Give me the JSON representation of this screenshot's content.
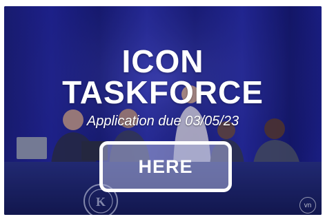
{
  "banner": {
    "title_line1": "ICON",
    "title_line2": "TASKFORCE",
    "subtitle": "Application due 03/05/23",
    "cta_label": "HERE",
    "watermark": "vn"
  },
  "colors": {
    "backdrop": "#10135e",
    "curtain": "#1a1f8a",
    "table_cloth": "#1b2469",
    "cta_fill": "#aab0d8",
    "text": "#ffffff"
  },
  "icons": {
    "watermark": "vn-logo-icon",
    "seal": "kiwanis-seal-icon"
  }
}
